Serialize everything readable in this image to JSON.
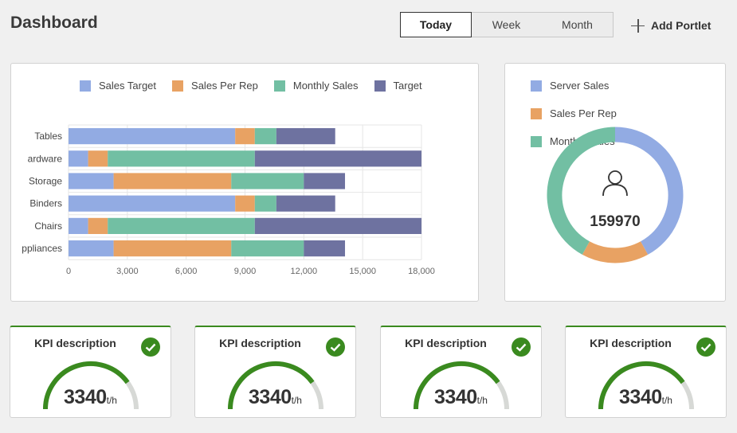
{
  "header": {
    "title": "Dashboard",
    "tabs": [
      "Today",
      "Week",
      "Month"
    ],
    "active_tab": "Today",
    "add_portlet_label": "Add Portlet"
  },
  "bar_chart": {
    "legend": [
      {
        "label": "Sales Target",
        "color": "#92abe3"
      },
      {
        "label": "Sales Per Rep",
        "color": "#e8a263"
      },
      {
        "label": "Monthly Sales",
        "color": "#72bfa3"
      },
      {
        "label": "Target",
        "color": "#6e72a0"
      }
    ]
  },
  "donut_chart": {
    "legend": [
      {
        "label": "Server Sales",
        "color": "#92abe3"
      },
      {
        "label": "Sales Per Rep",
        "color": "#e8a263"
      },
      {
        "label": "Monthly Sales",
        "color": "#72bfa3"
      }
    ],
    "center_value": "159970",
    "center_icon": "user-icon"
  },
  "kpis": [
    {
      "title": "KPI description",
      "value": "3340",
      "unit": "t/h",
      "status_icon": "check-icon",
      "fill": 0.8
    },
    {
      "title": "KPI description",
      "value": "3340",
      "unit": "t/h",
      "status_icon": "check-icon",
      "fill": 0.8
    },
    {
      "title": "KPI description",
      "value": "3340",
      "unit": "t/h",
      "status_icon": "check-icon",
      "fill": 0.8
    },
    {
      "title": "KPI description",
      "value": "3340",
      "unit": "t/h",
      "status_icon": "check-icon",
      "fill": 0.8
    }
  ],
  "chart_data": [
    {
      "type": "bar",
      "orientation": "horizontal",
      "stacked": true,
      "categories": [
        "Tables",
        "ardware",
        "Storage",
        "Binders",
        "Chairs",
        "ppliances"
      ],
      "series": [
        {
          "name": "Sales Target",
          "values": [
            8500,
            1000,
            2300,
            8500,
            1000,
            2300
          ]
        },
        {
          "name": "Sales Per Rep",
          "values": [
            1000,
            1000,
            6000,
            1000,
            1000,
            6000
          ]
        },
        {
          "name": "Monthly Sales",
          "values": [
            1100,
            7500,
            3700,
            1100,
            7500,
            3700
          ]
        },
        {
          "name": "Target",
          "values": [
            3000,
            8500,
            2100,
            3000,
            8500,
            2100
          ]
        }
      ],
      "xticks": [
        "0",
        "3,000",
        "6,000",
        "9,000",
        "12,000",
        "15,000",
        "18,000"
      ],
      "xlim": [
        0,
        18000
      ],
      "legend_position": "top",
      "grid": true
    },
    {
      "type": "pie",
      "donut": true,
      "labels": [
        "Server Sales",
        "Sales Per Rep",
        "Monthly Sales"
      ],
      "values": [
        42,
        16,
        42
      ],
      "center_text": "159970",
      "legend_position": "top"
    }
  ]
}
